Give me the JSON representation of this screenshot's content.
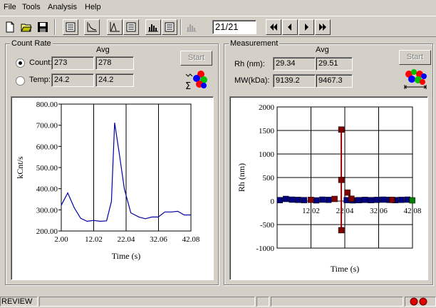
{
  "menu": [
    "File",
    "Tools",
    "Analysis",
    "Help"
  ],
  "toolbar": {
    "counter": "21/21",
    "icons": [
      "new-file-icon",
      "open-folder-icon",
      "save-icon",
      "list-icon",
      "curve-icon",
      "peak-icon",
      "table-icon",
      "histogram-icon",
      "report-icon",
      "histogram-disabled-icon",
      "first-icon",
      "prev-icon",
      "next-icon",
      "last-icon"
    ]
  },
  "count_rate": {
    "title": "Count Rate",
    "avg_label": "Avg",
    "count_label": "Count:",
    "count_value": "273",
    "count_avg": "278",
    "temp_label": "Temp:",
    "temp_value": "24.2",
    "temp_avg": "24.2",
    "selected": "count",
    "start_label": "Start"
  },
  "measurement": {
    "title": "Measurement",
    "avg_label": "Avg",
    "rh_label": "Rh (nm):",
    "rh_value": "29.34",
    "rh_avg": "29.51",
    "mw_label": "MW(kDa):",
    "mw_value": "9139.2",
    "mw_avg": "9467.3",
    "start_label": "Start"
  },
  "status": {
    "text": "REVIEW"
  },
  "colors": {
    "line": "#0000a0",
    "marker_blue": "#000080",
    "marker_red": "#800000",
    "marker_green": "#008000",
    "error_bar": "#a00000"
  },
  "chart_data": [
    {
      "type": "line",
      "xlabel": "Time (s)",
      "ylabel": "kCnt/s",
      "xlim": [
        2.0,
        42.08
      ],
      "ylim": [
        200,
        800
      ],
      "xticks": [
        "2.00",
        "12.02",
        "22.04",
        "32.06",
        "42.08"
      ],
      "yticks": [
        "200.00",
        "300.00",
        "400.00",
        "500.00",
        "600.00",
        "700.00",
        "800.00"
      ],
      "grid": "vertical",
      "series": [
        {
          "x": [
            2.0,
            4.0,
            6.0,
            8.0,
            10.0,
            12.0,
            14.0,
            16.0,
            17.5,
            18.5,
            20.0,
            21.5,
            23.5,
            26.0,
            28.0,
            30.0,
            32.0,
            34.0,
            36.0,
            38.0,
            40.0,
            42.08
          ],
          "values": [
            322,
            380,
            310,
            260,
            246,
            250,
            246,
            248,
            340,
            712,
            560,
            400,
            286,
            266,
            258,
            266,
            266,
            290,
            290,
            293,
            276,
            276
          ]
        }
      ]
    },
    {
      "type": "scatter",
      "xlabel": "Time (s)",
      "ylabel": "Rh (nm)",
      "xlim": [
        2.0,
        42.08
      ],
      "ylim": [
        -1000,
        2000
      ],
      "xticks": [
        "12.02",
        "22.04",
        "32.06",
        "42.08"
      ],
      "yticks": [
        "-1000",
        "-500",
        "0",
        "500",
        "1000",
        "1500",
        "2000"
      ],
      "grid": "both",
      "series": [
        {
          "name": "",
          "color": "blue",
          "points": [
            [
              2.8,
              20
            ],
            [
              4.6,
              45
            ],
            [
              6.4,
              30
            ],
            [
              8.2,
              25
            ],
            [
              10.0,
              20
            ],
            [
              13.6,
              15
            ],
            [
              15.4,
              30
            ],
            [
              17.2,
              25
            ],
            [
              22.6,
              20
            ],
            [
              24.4,
              15
            ],
            [
              26.2,
              20
            ],
            [
              28.0,
              25
            ],
            [
              29.8,
              20
            ],
            [
              31.6,
              25
            ],
            [
              33.4,
              30
            ],
            [
              35.2,
              25
            ],
            [
              37.0,
              20
            ],
            [
              38.8,
              25
            ],
            [
              40.6,
              30
            ]
          ]
        },
        {
          "name": "",
          "color": "red",
          "points": [
            [
              12.0,
              25
            ],
            [
              19.0,
              45
            ],
            [
              21.0,
              1520
            ],
            [
              21.0,
              450
            ],
            [
              21.0,
              -620
            ],
            [
              22.8,
              180
            ],
            [
              24.0,
              50
            ],
            [
              36.0,
              25
            ]
          ]
        },
        {
          "name": "",
          "color": "green",
          "points": [
            [
              42.0,
              15
            ]
          ]
        }
      ],
      "error_bar": {
        "x": 21.0,
        "low": -620,
        "high": 1520
      }
    }
  ]
}
